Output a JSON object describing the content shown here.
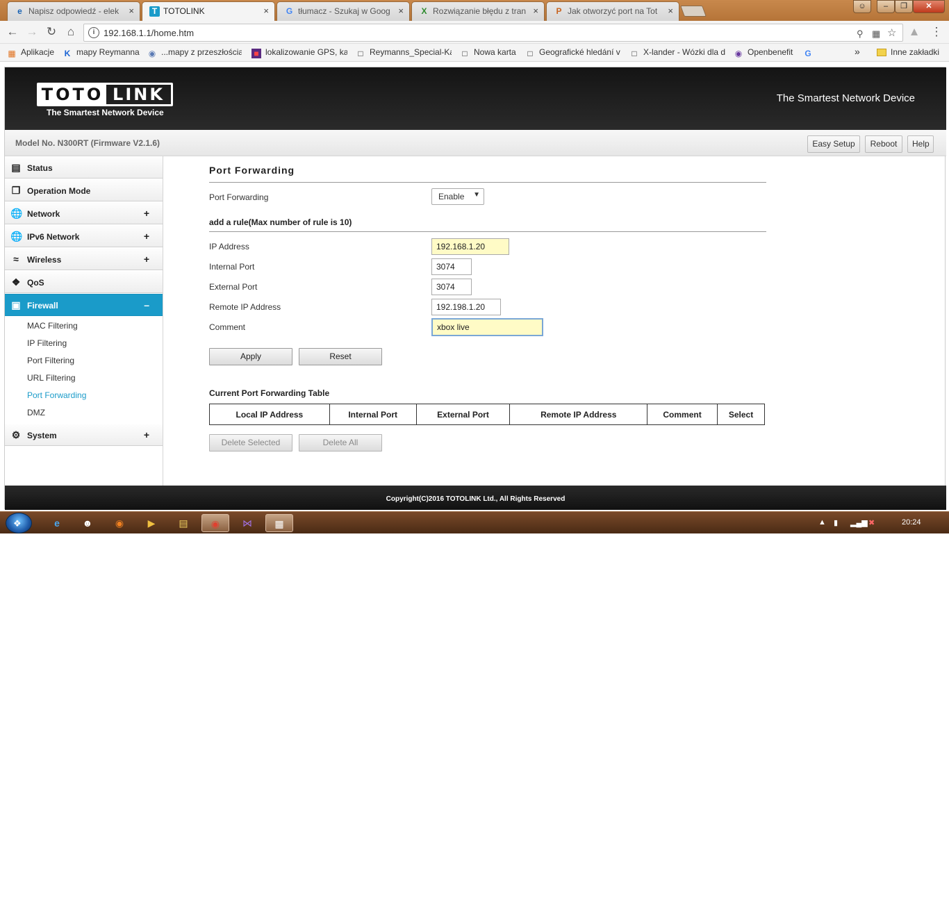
{
  "browser": {
    "tabs": [
      {
        "title": "Napisz odpowiedź - elek",
        "icon": "e"
      },
      {
        "title": "TOTOLINK",
        "icon": "T"
      },
      {
        "title": "tłumacz - Szukaj w Goog",
        "icon": "G"
      },
      {
        "title": "Rozwiązanie błędu z tran",
        "icon": "X"
      },
      {
        "title": "Jak otworzyć port na Tot",
        "icon": "P"
      }
    ],
    "tab_close": "×",
    "url": "192.168.1.1/home.htm",
    "bookmarks": [
      {
        "label": "Aplikacje",
        "icon": "apps-icon"
      },
      {
        "label": "mapy Reymanna",
        "icon": "k-icon"
      },
      {
        "label": "...mapy z przeszłością",
        "icon": "globe-icon"
      },
      {
        "label": "lokalizowanie GPS, ka",
        "icon": "gps-icon"
      },
      {
        "label": "Reymanns_Special-Ka",
        "icon": "page-icon"
      },
      {
        "label": "Nowa karta",
        "icon": "page-icon"
      },
      {
        "label": "Geografické hledání v",
        "icon": "page-icon"
      },
      {
        "label": "X-lander - Wózki dla d",
        "icon": "page-icon"
      },
      {
        "label": "Openbenefit",
        "icon": "openbenefit-icon"
      },
      {
        "label": "",
        "icon": "google-icon"
      }
    ],
    "more_bookmarks": "»",
    "other_bookmarks": "Inne zakładki"
  },
  "router": {
    "brand_left": "TOTO",
    "brand_right": "LINK",
    "logo_sub": "The Smartest Network Device",
    "tagline": "The Smartest Network Device",
    "model": "Model No. N300RT (Firmware V2.1.6)",
    "top_buttons": {
      "easy_setup": "Easy Setup",
      "reboot": "Reboot",
      "help": "Help"
    },
    "menu": [
      {
        "label": "Status",
        "icon": "status-icon",
        "toggle": ""
      },
      {
        "label": "Operation Mode",
        "icon": "operation-mode-icon",
        "toggle": ""
      },
      {
        "label": "Network",
        "icon": "globe-icon",
        "toggle": "+"
      },
      {
        "label": "IPv6 Network",
        "icon": "globe-icon",
        "toggle": "+"
      },
      {
        "label": "Wireless",
        "icon": "wifi-icon",
        "toggle": "+"
      },
      {
        "label": "QoS",
        "icon": "qos-icon",
        "toggle": ""
      },
      {
        "label": "Firewall",
        "icon": "lock-icon",
        "toggle": "–"
      },
      {
        "label": "System",
        "icon": "gear-icon",
        "toggle": "+"
      }
    ],
    "firewall_submenu": [
      "MAC Filtering",
      "IP Filtering",
      "Port Filtering",
      "URL Filtering",
      "Port Forwarding",
      "DMZ"
    ],
    "page": {
      "title": "Port Forwarding",
      "pf_label": "Port Forwarding",
      "pf_value": "Enable",
      "rule_heading": "add a rule(Max number of rule is 10)",
      "fields": {
        "ip_label": "IP Address",
        "ip_value": "192.168.1.20",
        "internal_label": "Internal Port",
        "internal_value": "3074",
        "external_label": "External Port",
        "external_value": "3074",
        "remote_label": "Remote IP Address",
        "remote_value": "192.198.1.20",
        "comment_label": "Comment",
        "comment_value": "xbox live"
      },
      "apply": "Apply",
      "reset": "Reset",
      "table_heading": "Current Port Forwarding Table",
      "table_headers": [
        "Local IP Address",
        "Internal Port",
        "External Port",
        "Remote IP Address",
        "Comment",
        "Select"
      ],
      "delete_selected": "Delete Selected",
      "delete_all": "Delete All"
    },
    "copyright": "Copyright(C)2016 TOTOLINK Ltd., All Rights Reserved"
  },
  "taskbar": {
    "clock": "20:24"
  },
  "colors": {
    "accent": "#1a9bc9",
    "highlight_input": "#fffbc6",
    "header_bg": "#1b1b1b"
  }
}
